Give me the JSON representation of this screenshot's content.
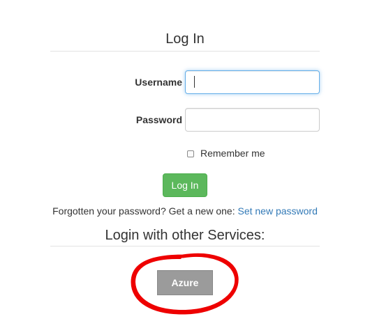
{
  "login": {
    "title": "Log In",
    "username_label": "Username",
    "username_value": "",
    "password_label": "Password",
    "password_value": "",
    "remember_label": "Remember me",
    "remember_checked": false,
    "submit_label": "Log In"
  },
  "forgot": {
    "text": "Forgotten your password? Get a new one: ",
    "link_label": "Set new password"
  },
  "other_services": {
    "title": "Login with other Services:",
    "azure_label": "Azure"
  },
  "colors": {
    "success": "#5cb85c",
    "link": "#337ab7",
    "focus": "#66afe9",
    "annotation": "#ee0000",
    "azure_button": "#9b9b9b"
  }
}
